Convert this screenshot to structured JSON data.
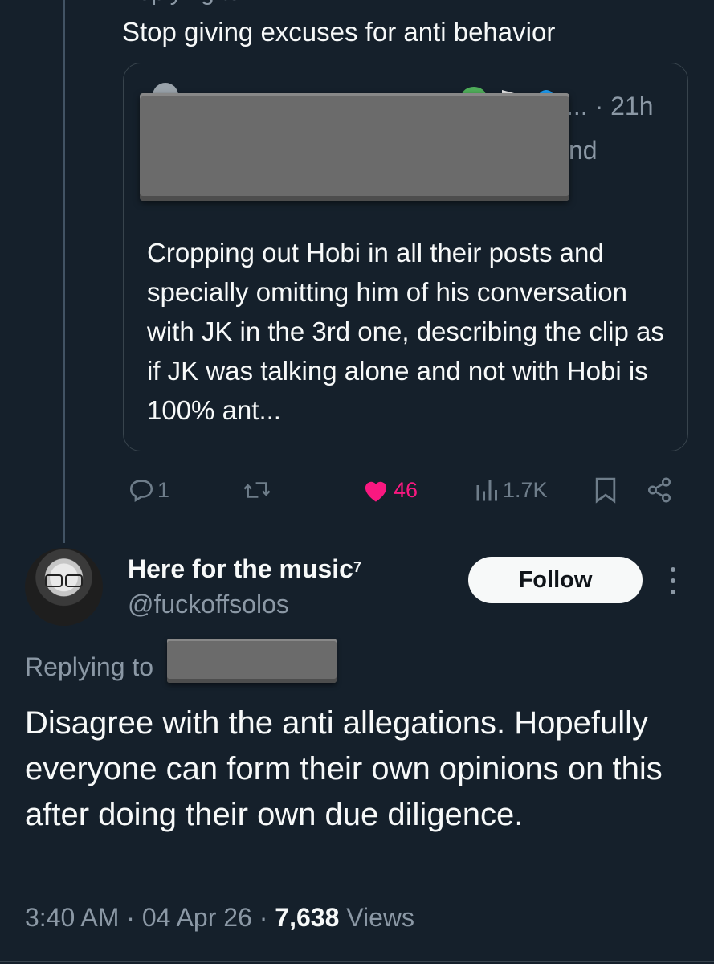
{
  "reply": {
    "text": "Stop giving excuses for anti behavior",
    "cut_top_text": "Replying to"
  },
  "quoted_tweet": {
    "time": "... · 21h",
    "visible_fragment": "nd",
    "body": "Cropping out Hobi in all their posts and specially omitting him of his conversation with JK in the 3rd one, describing the clip as if JK was talking alone and not with Hobi is 100% ant..."
  },
  "actions": {
    "replies": "1",
    "likes": "46",
    "views": "1.7K"
  },
  "author": {
    "name": "Here for the music",
    "name_suffix": "7",
    "handle": "@fuckoffsolos",
    "follow_label": "Follow"
  },
  "main_tweet": {
    "replying_to": "Replying to",
    "text": "Disagree with the anti allegations. Hopefully everyone can form their own opinions on this after doing their own due diligence.",
    "time": "3:40 AM",
    "date": "04 Apr 26",
    "views_count": "7,638",
    "views_label": "Views"
  },
  "colors": {
    "background": "#15202b",
    "text": "#f7f9f9",
    "muted": "#8b98a5",
    "like": "#f91880",
    "border": "#38444d"
  },
  "icons": [
    "reply-icon",
    "retweet-icon",
    "heart-icon",
    "analytics-icon",
    "bookmark-icon",
    "share-icon",
    "more-icon"
  ]
}
